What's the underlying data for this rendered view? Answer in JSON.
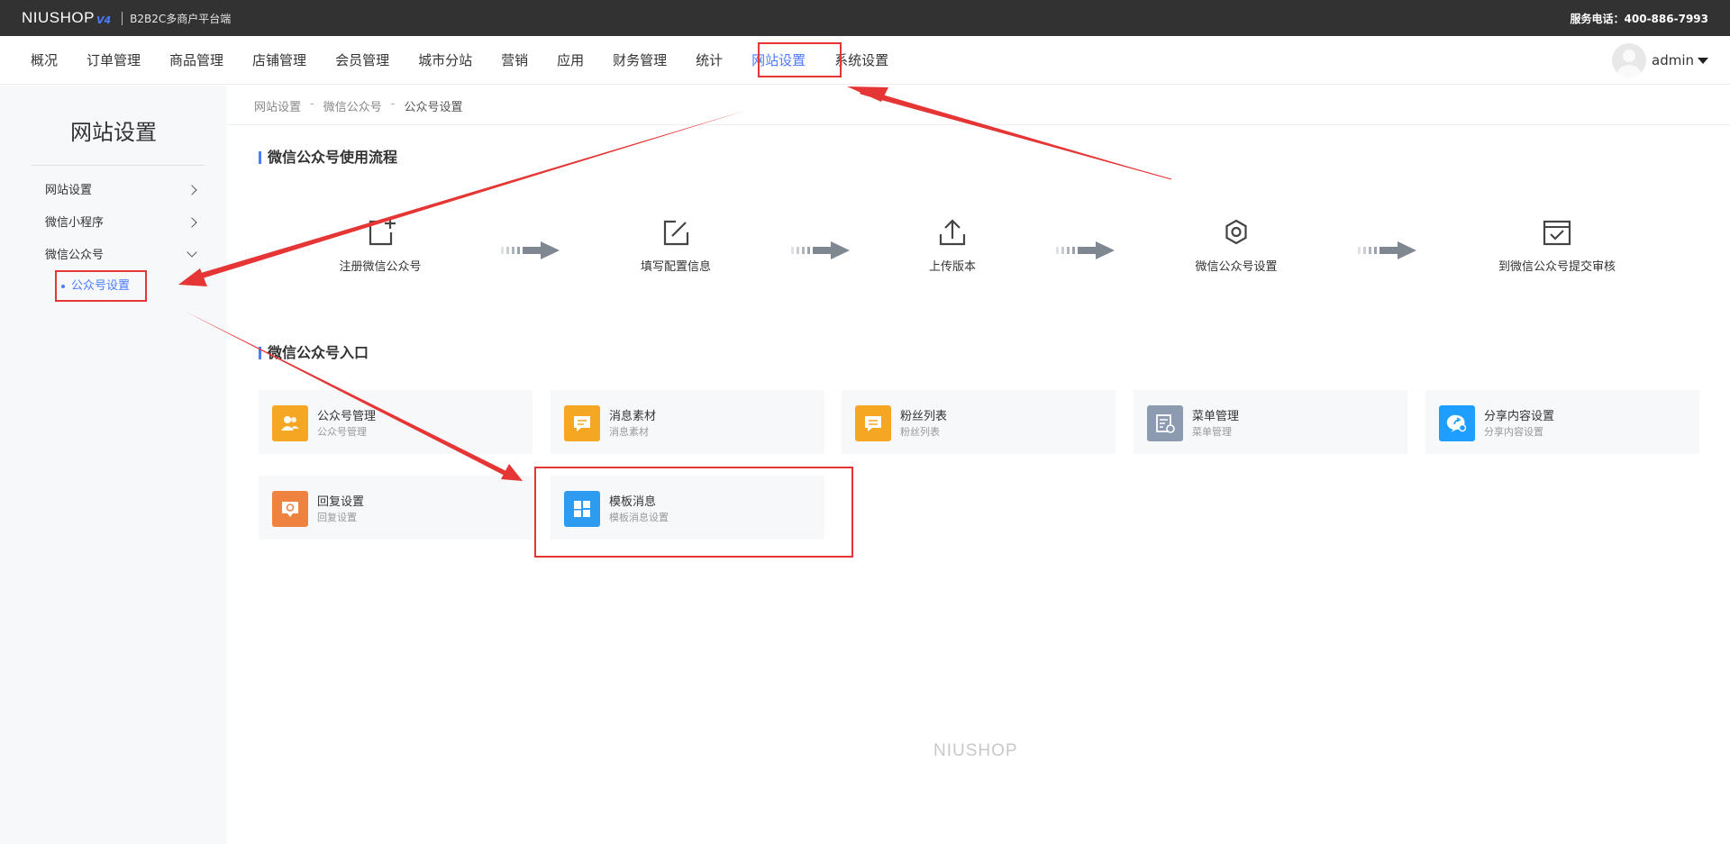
{
  "topbar": {
    "logo_text": "NIUSHOP",
    "logo_version": "V4",
    "subtitle": "B2B2C多商户平台端",
    "service": "服务电话：400-886-7993"
  },
  "nav": {
    "items": [
      "概况",
      "订单管理",
      "商品管理",
      "店铺管理",
      "会员管理",
      "城市分站",
      "营销",
      "应用",
      "财务管理",
      "统计",
      "网站设置",
      "系统设置"
    ],
    "active": "网站设置",
    "user": "admin"
  },
  "sidebar": {
    "title": "网站设置",
    "items": [
      {
        "label": "网站设置"
      },
      {
        "label": "微信小程序"
      },
      {
        "label": "微信公众号"
      }
    ],
    "sub_item": "公众号设置"
  },
  "breadcrumb": [
    "网站设置",
    "微信公众号",
    "公众号设置"
  ],
  "breadcrumb_sep": "-",
  "flow": {
    "title": "微信公众号使用流程",
    "steps": [
      {
        "label": "注册微信公众号",
        "icon": "add-square-icon"
      },
      {
        "label": "填写配置信息",
        "icon": "edit-icon"
      },
      {
        "label": "上传版本",
        "icon": "upload-icon"
      },
      {
        "label": "微信公众号设置",
        "icon": "gear-icon"
      },
      {
        "label": "到微信公众号提交审核",
        "icon": "check-calendar-icon"
      }
    ]
  },
  "entry": {
    "title": "微信公众号入口",
    "cards": [
      {
        "title": "公众号管理",
        "desc": "公众号管理",
        "color": "#f5a623",
        "icon": "users-icon"
      },
      {
        "title": "消息素材",
        "desc": "消息素材",
        "color": "#f5a623",
        "icon": "message-icon"
      },
      {
        "title": "粉丝列表",
        "desc": "粉丝列表",
        "color": "#f5a623",
        "icon": "fans-list-icon"
      },
      {
        "title": "菜单管理",
        "desc": "菜单管理",
        "color": "#8d9bb1",
        "icon": "menu-manage-icon"
      },
      {
        "title": "分享内容设置",
        "desc": "分享内容设置",
        "color": "#1e9fff",
        "icon": "share-icon"
      },
      {
        "title": "回复设置",
        "desc": "回复设置",
        "color": "#f08240",
        "icon": "reply-icon"
      },
      {
        "title": "模板消息",
        "desc": "模板消息设置",
        "color": "#2d9bf0",
        "icon": "template-icon"
      }
    ]
  },
  "footer": {
    "logo": "NIUSHOP"
  },
  "colors": {
    "accent": "#4a7cff",
    "highlight": "#e53535",
    "topbar": "#323232"
  }
}
